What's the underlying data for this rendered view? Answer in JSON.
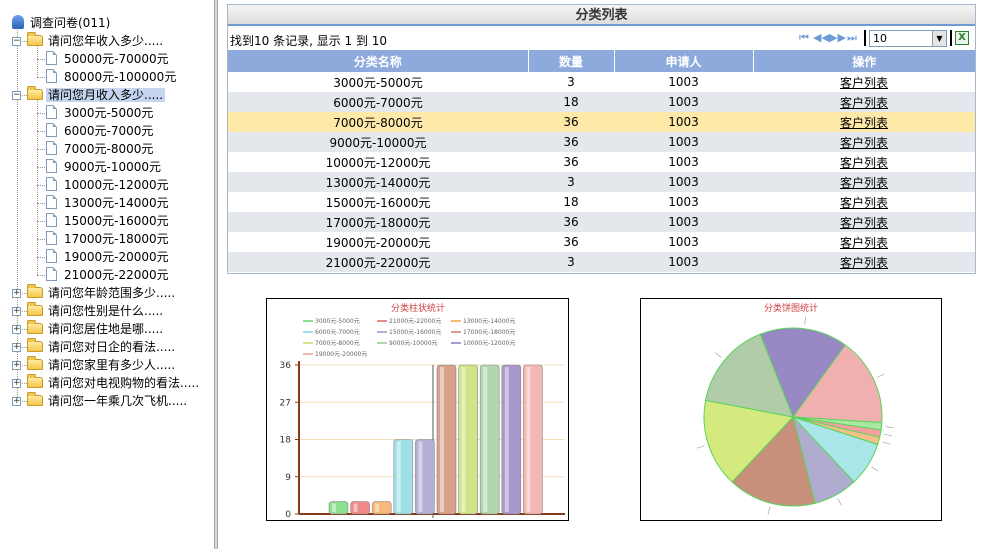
{
  "tree": {
    "root_label": "调查问卷(011)",
    "nodes": [
      {
        "label": "请问您年收入多少.....",
        "expanded": true,
        "children": [
          "50000元-70000元",
          "80000元-100000元"
        ]
      },
      {
        "label": "请问您月收入多少.....",
        "expanded": true,
        "selected": true,
        "children": [
          "3000元-5000元",
          "6000元-7000元",
          "7000元-8000元",
          "9000元-10000元",
          "10000元-12000元",
          "13000元-14000元",
          "15000元-16000元",
          "17000元-18000元",
          "19000元-20000元",
          "21000元-22000元"
        ]
      },
      {
        "label": "请问您年龄范围多少.....",
        "expanded": false
      },
      {
        "label": "请问您性别是什么.....",
        "expanded": false
      },
      {
        "label": "请问您居住地是哪.....",
        "expanded": false
      },
      {
        "label": "请问您对日企的看法.....",
        "expanded": false
      },
      {
        "label": "请问您家里有多少人.....",
        "expanded": false
      },
      {
        "label": "请问您对电视购物的看法.....",
        "expanded": false
      },
      {
        "label": "请问您一年乘几次飞机.....",
        "expanded": false
      }
    ]
  },
  "panel": {
    "title": "分类列表",
    "record_info": "找到10 条记录, 显示  1 到  10",
    "page_size": "10",
    "columns": [
      "分类名称",
      "数量",
      "申请人",
      "操作"
    ],
    "rows": [
      {
        "name": "3000元-5000元",
        "count": "3",
        "applicant": "1003",
        "action": "客户列表"
      },
      {
        "name": "6000元-7000元",
        "count": "18",
        "applicant": "1003",
        "action": "客户列表"
      },
      {
        "name": "7000元-8000元",
        "count": "36",
        "applicant": "1003",
        "action": "客户列表"
      },
      {
        "name": "9000元-10000元",
        "count": "36",
        "applicant": "1003",
        "action": "客户列表"
      },
      {
        "name": "10000元-12000元",
        "count": "36",
        "applicant": "1003",
        "action": "客户列表"
      },
      {
        "name": "13000元-14000元",
        "count": "3",
        "applicant": "1003",
        "action": "客户列表"
      },
      {
        "name": "15000元-16000元",
        "count": "18",
        "applicant": "1003",
        "action": "客户列表"
      },
      {
        "name": "17000元-18000元",
        "count": "36",
        "applicant": "1003",
        "action": "客户列表"
      },
      {
        "name": "19000元-20000元",
        "count": "36",
        "applicant": "1003",
        "action": "客户列表"
      },
      {
        "name": "21000元-22000元",
        "count": "3",
        "applicant": "1003",
        "action": "客户列表"
      }
    ],
    "highlight_row": 2
  },
  "chart_data": [
    {
      "type": "bar",
      "title": "分类柱状统计",
      "legend": [
        "3000元-5000元",
        "21000元-22000元",
        "13000元-14000元",
        "6000元-7000元",
        "15000元-16000元",
        "17000元-18000元",
        "7000元-8000元",
        "9000元-10000元",
        "10000元-12000元",
        "19000元-20000元"
      ],
      "bars": [
        {
          "category": "3000元-5000元",
          "value": 3,
          "color": "#8ee08e"
        },
        {
          "category": "21000元-22000元",
          "value": 3,
          "color": "#f08a8a"
        },
        {
          "category": "13000元-14000元",
          "value": 3,
          "color": "#f6b97a"
        },
        {
          "category": "6000元-7000元",
          "value": 18,
          "color": "#9fe0e6"
        },
        {
          "category": "15000元-16000元",
          "value": 18,
          "color": "#b4b0d4"
        },
        {
          "category": "17000元-18000元",
          "value": 36,
          "color": "#d9a08a"
        },
        {
          "category": "7000元-8000元",
          "value": 36,
          "color": "#cfe58a"
        },
        {
          "category": "9000元-10000元",
          "value": 36,
          "color": "#b0d8b0"
        },
        {
          "category": "10000元-12000元",
          "value": 36,
          "color": "#a898cc"
        },
        {
          "category": "19000元-20000元",
          "value": 36,
          "color": "#f2b8b4"
        }
      ],
      "ylim": [
        0,
        36
      ],
      "yticks": [
        "36",
        "27",
        "18",
        "9",
        "0"
      ],
      "grid": true
    },
    {
      "type": "pie",
      "title": "分类饼图统计",
      "slices": [
        {
          "value": 36,
          "color": "#9888c4"
        },
        {
          "value": 36,
          "color": "#f0b0b0"
        },
        {
          "value": 3,
          "color": "#a8e8a0"
        },
        {
          "value": 3,
          "color": "#f4a0a0"
        },
        {
          "value": 3,
          "color": "#f6c08a"
        },
        {
          "value": 18,
          "color": "#a8e6ea"
        },
        {
          "value": 18,
          "color": "#b0acd0"
        },
        {
          "value": 36,
          "color": "#c8907a"
        },
        {
          "value": 36,
          "color": "#d4ea7e"
        },
        {
          "value": 36,
          "color": "#b0cca8"
        }
      ]
    }
  ]
}
